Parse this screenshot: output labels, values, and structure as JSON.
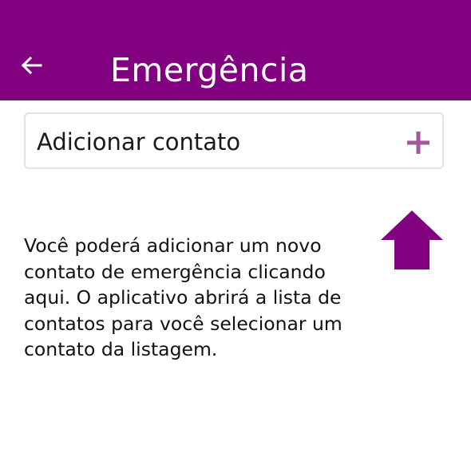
{
  "colors": {
    "primary": "#800080",
    "accent_plus": "#a2579b",
    "card_border": "#e2e2e2"
  },
  "header": {
    "back_icon": "arrow-left-icon",
    "title": "Emergência"
  },
  "add_contact": {
    "label": "Adicionar contato",
    "icon": "plus-icon"
  },
  "hint": {
    "icon": "arrow-up-icon",
    "text": "Você poderá adicionar um novo contato de emergência clicando aqui. O aplicativo abrirá a lista de contatos para você selecionar um contato da listagem."
  }
}
